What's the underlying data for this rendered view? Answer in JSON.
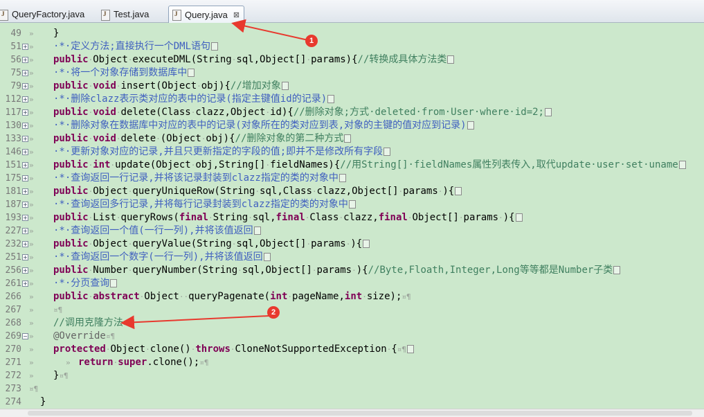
{
  "tabs": [
    {
      "label": "QueryFactory.java",
      "active": false
    },
    {
      "label": "Test.java",
      "active": false
    },
    {
      "label": "Query.java",
      "active": true,
      "close": "⊠"
    }
  ],
  "editor": {
    "lines": [
      {
        "num": "49",
        "fold": "",
        "body": "}"
      },
      {
        "num": "51",
        "fold": "+",
        "body": "·*·定义方法;直接执行一个DML语句"
      },
      {
        "num": "56",
        "fold": "+",
        "body": "public·Object·executeDML(String·sql,Object[]·params){//转换成具体方法类"
      },
      {
        "num": "75",
        "fold": "+",
        "body": "·*·将一个对象存储到数据库中"
      },
      {
        "num": "79",
        "fold": "+",
        "body": "public·void·insert(Object·obj){//增加对象"
      },
      {
        "num": "112",
        "fold": "+",
        "body": "·*·删除clazz表示类对应的表中的记录(指定主键值id的记录)"
      },
      {
        "num": "117",
        "fold": "+",
        "body": "public·void·delete(Class·clazz,Object·id){//删除对象;方式·deleted·from·User·where·id=2;"
      },
      {
        "num": "130",
        "fold": "+",
        "body": "·*·删除对象在数据库中对应的表中的记录(对象所在的类对应到表,对象的主键的值对应到记录)"
      },
      {
        "num": "133",
        "fold": "+",
        "body": "public·void·delete·(Object·obj){//删除对象的第二种方式"
      },
      {
        "num": "146",
        "fold": "+",
        "body": "·*·更新对象对应的记录,并且只更新指定的字段的值;即并不是修改所有字段"
      },
      {
        "num": "151",
        "fold": "+",
        "body": "public·int·update(Object·obj,String[]·fieldNames){//用String[]·fieldNames属性列表传入,取代update·user·set·uname"
      },
      {
        "num": "175",
        "fold": "+",
        "body": "·*·查询返回一行记录,并将该记录封装到clazz指定的类的对象中"
      },
      {
        "num": "181",
        "fold": "+",
        "body": "public·Object·queryUniqueRow(String·sql,Class·clazz,Object[]·params·){"
      },
      {
        "num": "187",
        "fold": "+",
        "body": "·*·查询返回多行记录,并将每行记录封装到clazz指定的类的对象中"
      },
      {
        "num": "193",
        "fold": "+",
        "body": "public·List·queryRows(final·String·sql,final·Class·clazz,final·Object[]·params·){"
      },
      {
        "num": "227",
        "fold": "+",
        "body": "·*·查询返回一个值(一行一列),并将该值返回"
      },
      {
        "num": "232",
        "fold": "+",
        "body": "public·Object·queryValue(String·sql,Object[]·params·){"
      },
      {
        "num": "251",
        "fold": "+",
        "body": "·*·查询返回一个数字(一行一列),并将该值返回"
      },
      {
        "num": "256",
        "fold": "+",
        "body": "public·Number·queryNumber(String·sql,Object[]·params·){//Byte,Floath,Integer,Long等等都是Number子类"
      },
      {
        "num": "261",
        "fold": "+",
        "body": "·*·分页查询"
      },
      {
        "num": "266",
        "fold": "",
        "body": "public·abstract·Object··queryPagenate(int·pageName,int·size);¤¶"
      },
      {
        "num": "267",
        "fold": "",
        "body": "¤¶"
      },
      {
        "num": "268",
        "fold": "",
        "body": "//调用克隆方法¤"
      },
      {
        "num": "269",
        "fold": "-",
        "body": "@Override¤¶"
      },
      {
        "num": "270",
        "fold": "",
        "body": "protected·Object·clone()·throws·CloneNotSupportedException·{¤¶"
      },
      {
        "num": "271",
        "fold": "",
        "body": "return·super.clone();¤¶"
      },
      {
        "num": "272",
        "fold": "",
        "body": "}¤¶"
      },
      {
        "num": "273",
        "fold": "",
        "body": "}¤¶"
      },
      {
        "num": "274",
        "fold": "",
        "body": "}"
      }
    ]
  },
  "annotations": [
    {
      "label": "1"
    },
    {
      "label": "2"
    }
  ],
  "colors": {
    "editor_bg": "#cce8cc",
    "keyword": "#7f0055",
    "comment": "#3f7f5f",
    "javadoc": "#3f5fbf",
    "annotation_marker": "#e8392e"
  }
}
